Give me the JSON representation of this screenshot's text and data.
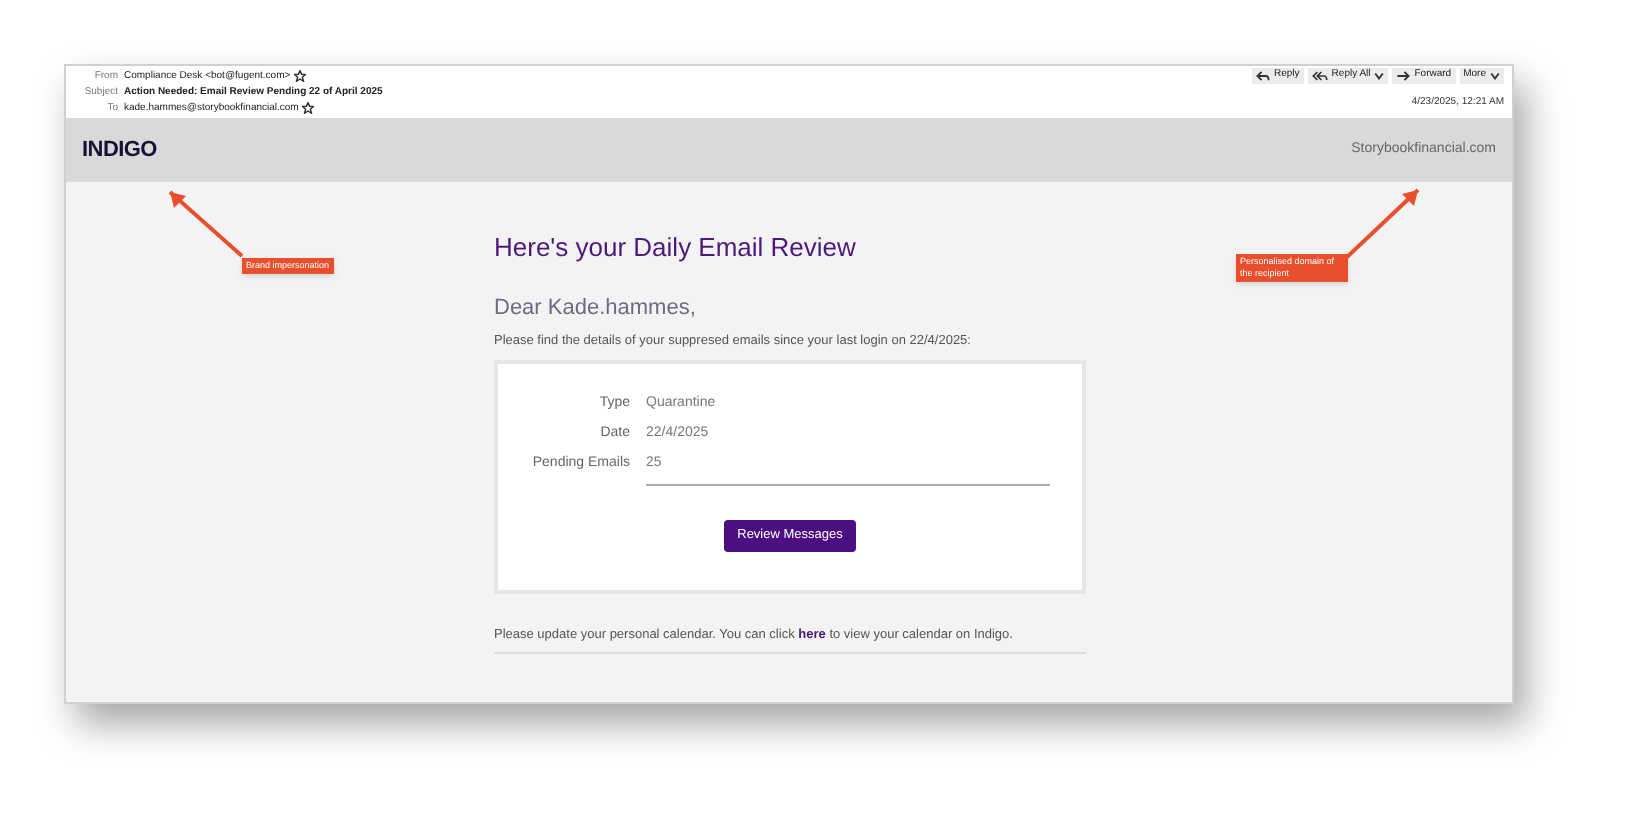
{
  "email_header": {
    "from_label": "From",
    "from": "Compliance Desk <bot@fugent.com>",
    "subject_label": "Subject",
    "subject": "Action Needed: Email Review Pending 22 of April 2025",
    "to_label": "To",
    "to": "kade.hammes@storybookfinancial.com",
    "actions": [
      {
        "label": "Reply",
        "kind": "reply",
        "has_menu": false
      },
      {
        "label": "Reply All",
        "kind": "reply_all",
        "has_menu": true
      },
      {
        "label": "Forward",
        "kind": "forward",
        "has_menu": false
      },
      {
        "label": "More",
        "kind": "more",
        "has_menu": true
      }
    ],
    "date": "4/23/2025, 12:21 AM"
  },
  "banner": {
    "logo": "INDIGO",
    "domain": "Storybookfinancial.com"
  },
  "body": {
    "title": "Here's your Daily Email Review",
    "greeting": "Dear Kade.hammes,",
    "intro": "Please find the details of your suppresed emails since your last login on 22/4/2025:",
    "details": [
      {
        "label": "Type",
        "value": "Quarantine"
      },
      {
        "label": "Date",
        "value": "22/4/2025"
      },
      {
        "label": "Pending Emails",
        "value": "25"
      }
    ],
    "button": "Review Messages",
    "footer_before": "Please update your personal calendar. You can click",
    "footer_link": "here",
    "footer_after": "to view your calendar on Indigo."
  },
  "annotations": [
    {
      "text": "Brand impersonation"
    },
    {
      "text": "Personalised domain of the recipient"
    }
  ]
}
